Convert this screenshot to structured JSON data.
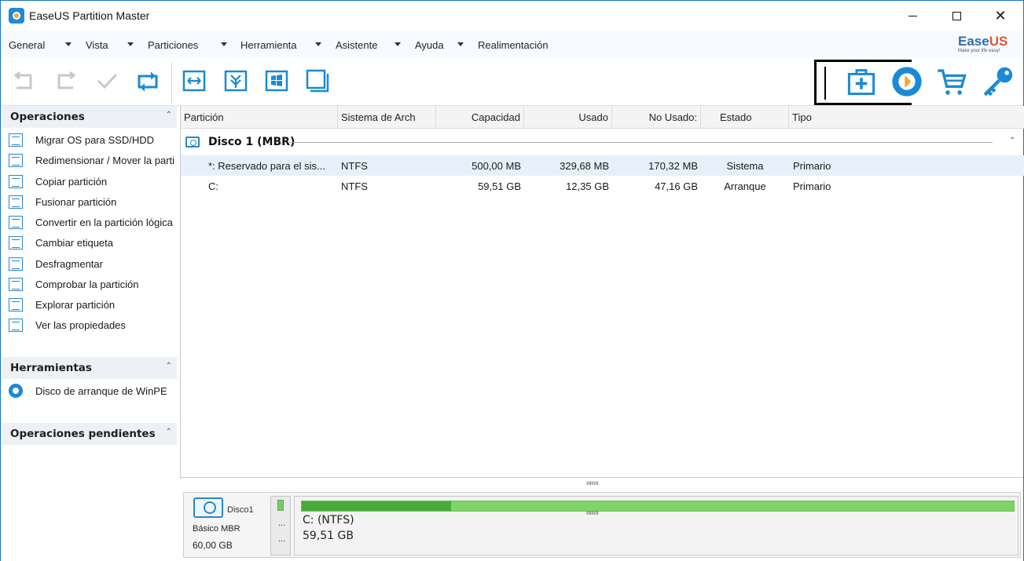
{
  "window": {
    "title": "EaseUS Partition Master",
    "minimize_glyph": "—",
    "close_glyph": "✕"
  },
  "menu": [
    {
      "label": "General"
    },
    {
      "label": "Vista"
    },
    {
      "label": "Particiones"
    },
    {
      "label": "Herramienta"
    },
    {
      "label": "Asistente"
    },
    {
      "label": "Ayuda"
    },
    {
      "label": "Realimentación"
    }
  ],
  "brand": {
    "name_a": "Ease",
    "name_b": "US",
    "tagline": "Make your life easy!"
  },
  "toolbar": {
    "left_icons": [
      "undo-icon",
      "redo-icon",
      "apply-icon",
      "refresh-icon"
    ],
    "partition_icons": [
      "resize-move-icon",
      "merge-icon",
      "migrate-os-icon",
      "copy-icon"
    ],
    "right_icons": [
      "backup-icon",
      "recovery-icon",
      "cart-icon",
      "key-icon"
    ],
    "accent": "#1a8ad4",
    "disabled": "#c8c8c8"
  },
  "operations": {
    "title": "Operaciones",
    "items": [
      {
        "label": "Migrar OS para SSD/HDD"
      },
      {
        "label": "Redimensionar / Mover la parti"
      },
      {
        "label": "Copiar partición"
      },
      {
        "label": "Fusionar partición"
      },
      {
        "label": "Convertir en la partición lógica"
      },
      {
        "label": "Cambiar etiqueta"
      },
      {
        "label": "Desfragmentar"
      },
      {
        "label": "Comprobar la partición"
      },
      {
        "label": "Explorar partición"
      },
      {
        "label": "Ver las propiedades"
      }
    ]
  },
  "tools": {
    "title": "Herramientas",
    "items": [
      {
        "label": "Disco de arranque de WinPE"
      }
    ]
  },
  "pending": {
    "title": "Operaciones pendientes"
  },
  "collapse_glyph": "⌃",
  "table": {
    "columns": [
      "Partición",
      "Sistema de Arch",
      "Capacidad",
      "Usado",
      "No Usado:",
      "Estado",
      "Tipo"
    ],
    "disk_label": "Disco 1 (MBR)",
    "rows": [
      {
        "particion": "*: Reservado para el sis...",
        "sistema": "NTFS",
        "capacidad": "500,00 MB",
        "usado": "329,68 MB",
        "no_usado": "170,32 MB",
        "estado": "Sistema",
        "tipo": "Primario",
        "selected": true
      },
      {
        "particion": "C:",
        "sistema": "NTFS",
        "capacidad": "59,51 GB",
        "usado": "12,35 GB",
        "no_usado": "47,16 GB",
        "estado": "Arranque",
        "tipo": "Primario",
        "selected": false
      }
    ]
  },
  "disk_map": {
    "disk_name": "Disco1",
    "type": "Básico MBR",
    "size": "60,00 GB",
    "small_dots": "...",
    "partition_name": "C: (NTFS)",
    "partition_size": "59,51 GB",
    "used_fraction": 0.21,
    "splitter": "ııııııı"
  }
}
